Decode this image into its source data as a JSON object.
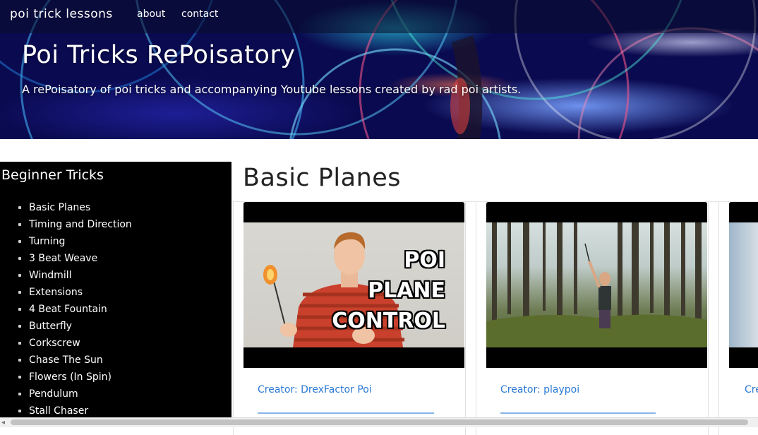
{
  "nav": {
    "brand": "poi trick lessons",
    "links": [
      {
        "label": "about"
      },
      {
        "label": "contact"
      }
    ]
  },
  "hero": {
    "title": "Poi Tricks RePoisatory",
    "subtitle": "A rePoisatory of poi tricks and accompanying Youtube lessons created by rad poi artists."
  },
  "sidebar": {
    "title": "Beginner Tricks",
    "items": [
      {
        "label": "Basic Planes"
      },
      {
        "label": "Timing and Direction"
      },
      {
        "label": "Turning"
      },
      {
        "label": "3 Beat Weave"
      },
      {
        "label": "Windmill"
      },
      {
        "label": "Extensions"
      },
      {
        "label": "4 Beat Fountain"
      },
      {
        "label": "Butterfly"
      },
      {
        "label": "Corkscrew"
      },
      {
        "label": "Chase The Sun"
      },
      {
        "label": "Flowers (In Spin)"
      },
      {
        "label": "Pendulum"
      },
      {
        "label": "Stall Chaser"
      }
    ]
  },
  "main": {
    "title": "Basic Planes",
    "cards": [
      {
        "creator": "Creator: DrexFactor Poi",
        "thumbnail_text": [
          "POI",
          "PLANE",
          "CONTROL"
        ]
      },
      {
        "creator": "Creator: playpoi"
      },
      {
        "creator": "Cre"
      }
    ]
  },
  "colors": {
    "link": "#2a79d4",
    "sidebar_bg": "#000000",
    "header_overlay": "#0a0c28"
  }
}
